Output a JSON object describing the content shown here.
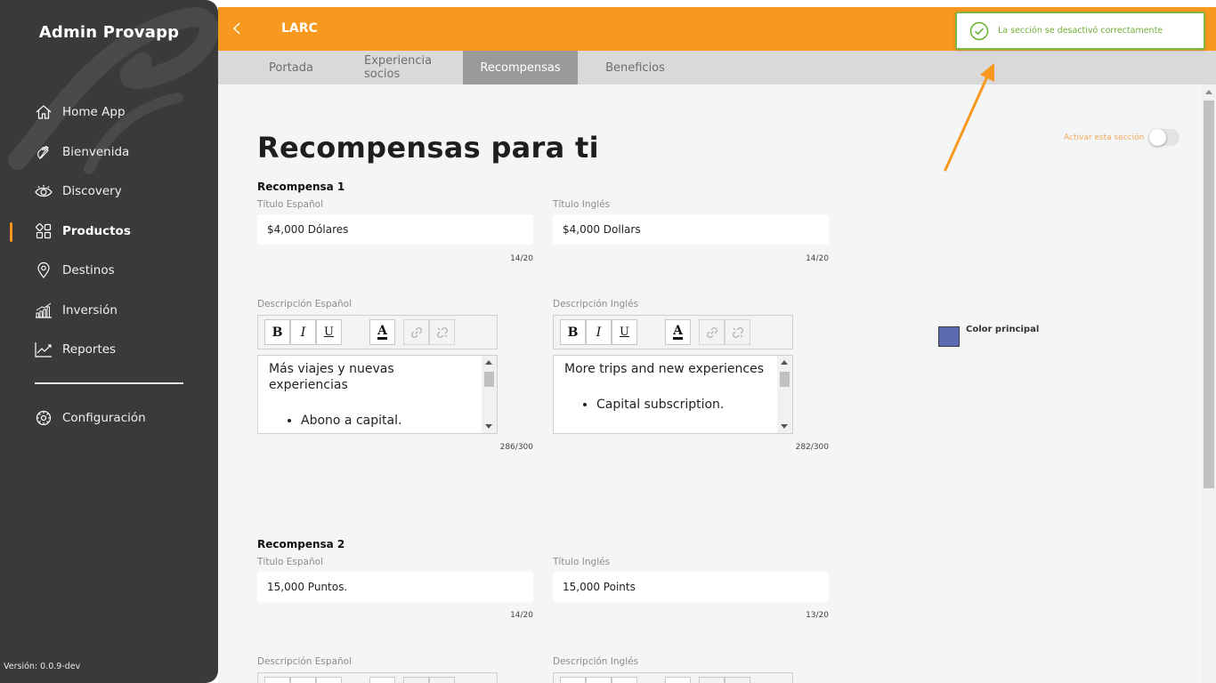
{
  "sidebar": {
    "brand": "Admin Provapp",
    "items": [
      {
        "label": "Home App",
        "icon": "home-icon"
      },
      {
        "label": "Bienvenida",
        "icon": "wave-hand-icon"
      },
      {
        "label": "Discovery",
        "icon": "eye-icon"
      },
      {
        "label": "Productos",
        "icon": "grid-icon",
        "active": true
      },
      {
        "label": "Destinos",
        "icon": "map-pin-icon"
      },
      {
        "label": "Inversión",
        "icon": "bar-chart-icon"
      },
      {
        "label": "Reportes",
        "icon": "line-chart-icon"
      }
    ],
    "config": {
      "label": "Configuración",
      "icon": "gear-icon"
    },
    "version": "Versión: 0.0.9-dev"
  },
  "header": {
    "title": "LARC"
  },
  "tabs": [
    {
      "label": "Portada"
    },
    {
      "label": "Experiencia socios"
    },
    {
      "label": "Recompensas",
      "active": true
    },
    {
      "label": "Beneficios"
    }
  ],
  "toast": {
    "message": "La sección se desactivó correctamente"
  },
  "main": {
    "title": "Recompensas para ti",
    "activate_label": "Activar esta sección",
    "activate_on": false,
    "color_label": "Color principal",
    "color_value": "#5b6bb1",
    "rewards": [
      {
        "heading": "Recompensa 1",
        "title_es_label": "Título Español",
        "title_es": "$4,000 Dólares",
        "title_es_count": "14/20",
        "title_en_label": "Título Inglés",
        "title_en": "$4,000 Dollars",
        "title_en_count": "14/20",
        "desc_es_label": "Descripción Español",
        "desc_es_text": "Más viajes y nuevas experiencias",
        "desc_es_bullet": "Abono a capital.",
        "desc_es_count": "286/300",
        "desc_en_label": "Descripción Inglés",
        "desc_en_text": "More trips and new experiences",
        "desc_en_bullet": "Capital subscription.",
        "desc_en_count": "282/300"
      },
      {
        "heading": "Recompensa 2",
        "title_es_label": "Título Español",
        "title_es": "15,000 Puntos.",
        "title_es_count": "14/20",
        "title_en_label": "Título Inglés",
        "title_en": "15,000 Points",
        "title_en_count": "13/20",
        "desc_es_label": "Descripción Español",
        "desc_en_label": "Descripción Inglés"
      }
    ]
  },
  "colors": {
    "accent": "#f7981f",
    "sidebar_bg": "#3a3a3a",
    "success": "#7db843"
  }
}
